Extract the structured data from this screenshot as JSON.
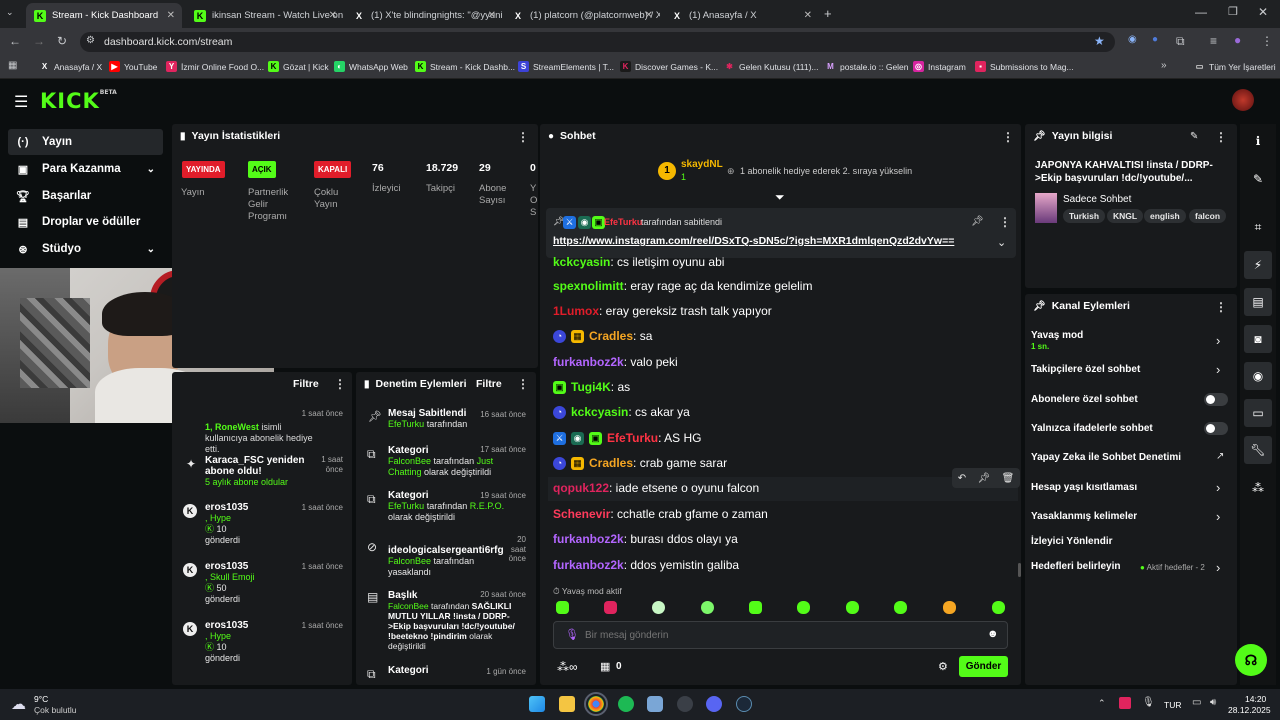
{
  "browser": {
    "tabs": [
      {
        "title": "Stream - Kick Dashboard",
        "active": true
      },
      {
        "title": "ikinsan Stream - Watch Live on"
      },
      {
        "title": "(1) X'te blindingnights: \"@yyuni"
      },
      {
        "title": "(1) platcorn (@platcornweb) / X"
      },
      {
        "title": "(1) Anasayfa / X"
      }
    ],
    "url": "dashboard.kick.com/stream",
    "bookmarks": [
      "Anasayfa / X",
      "YouTube",
      "İzmir Online Food O...",
      "Gözat | Kick",
      "WhatsApp Web",
      "Stream - Kick Dashb...",
      "StreamElements | T...",
      "Discover Games - K...",
      "Gelen Kutusu (111)...",
      "postale.io :: Gelen",
      "Instagram",
      "Submissions to Mag..."
    ],
    "all_bookmarks": "Tüm Yer İşaretleri"
  },
  "logo": {
    "text": "KICK",
    "beta": "BETA"
  },
  "sidebar": [
    {
      "label": "Yayın",
      "icon": "broadcast-icon"
    },
    {
      "label": "Para Kazanma",
      "icon": "money-icon"
    },
    {
      "label": "Başarılar",
      "icon": "trophy-icon"
    },
    {
      "label": "Droplar ve ödüller",
      "icon": "gift-icon"
    },
    {
      "label": "Stüdyo",
      "icon": "studio-icon"
    }
  ],
  "stats": {
    "title": "Yayın İstatistikleri",
    "badges": [
      {
        "text": "YAYINDA",
        "label": "Yayın",
        "color": "#e11d2a"
      },
      {
        "text": "AÇIK",
        "label": "Partnerlik Gelir Programı",
        "color": "#53fc18"
      },
      {
        "text": "KAPALI",
        "label": "Çoklu Yayın",
        "color": "#e11d2a"
      }
    ],
    "numbers": [
      {
        "value": "76",
        "label": "İzleyici"
      },
      {
        "value": "18.729",
        "label": "Takipçi"
      },
      {
        "value": "29",
        "label": "Abone Sayısı"
      },
      {
        "value": "0",
        "label": "Y O S"
      }
    ]
  },
  "activity": {
    "filter": "Filtre",
    "items": [
      {
        "user": "1, RoneWest",
        "text": "isimli kullanıcıya abonelik hediye etti.",
        "time": "1 saat önce"
      },
      {
        "user": "Karaca_FSC yeniden abone oldu!",
        "text": "5 aylık abone oldular",
        "time": "1 saat önce"
      },
      {
        "user": "eros1035",
        "sub": ", Hype",
        "amount": "10",
        "note": "gönderdi",
        "time": "1 saat önce"
      },
      {
        "user": "eros1035",
        "sub": ", Skull Emoji",
        "amount": "50",
        "note": "gönderdi",
        "time": "1 saat önce"
      },
      {
        "user": "eros1035",
        "sub": ", Hype",
        "amount": "10",
        "note": "gönderdi",
        "time": "1 saat önce"
      }
    ]
  },
  "moderation": {
    "title": "Denetim Eylemleri",
    "filter": "Filtre",
    "items": [
      {
        "title": "Mesaj Sabitlendi",
        "by": "EfeTurku",
        "rest": "tarafından",
        "time": "16 saat önce"
      },
      {
        "title": "Kategori",
        "by": "FalconBee",
        "rest": "tarafından",
        "extra": "Just Chatting",
        "rest2": "olarak değiştirildi",
        "time": "17 saat önce"
      },
      {
        "title": "Kategori",
        "by": "EfeTurku",
        "rest": "tarafından",
        "extra": "R.E.P.O.",
        "rest2": "olarak değiştirildi",
        "time": "19 saat önce"
      },
      {
        "title": "ideologicalsergeanti6rfg",
        "by": "FalconBee",
        "rest": "tarafından yasaklandı",
        "time": "20 saat önce"
      },
      {
        "title": "Başlık",
        "by": "FalconBee",
        "rest": "tarafından",
        "extra": "SAĞLIKLI MUTLU YILLAR !insta / DDRP->Ekip başvuruları !dc/!youtube/ !beetekno !pindirim",
        "rest2": "olarak değiştirildi",
        "time": "20 saat önce"
      },
      {
        "title": "Kategori",
        "time": "1 gün önce"
      }
    ]
  },
  "chat": {
    "title": "Sohbet",
    "gifter": {
      "name": "skaydNL",
      "count": "1",
      "rank": "1"
    },
    "gift_msg": "1 abonelik hediye ederek 2. sıraya yükselin",
    "pinned_by": "EfeTurku",
    "pinned_suffix": "tarafından sabitlendi",
    "pinned_link": "https://www.instagram.com/reel/DSxTQ-sDN5c/?igsh=MXR1dmlqenQzd2dvYw==",
    "messages": [
      {
        "user": "kckcyasin",
        "color": "#53fc18",
        "text": ": cs iletişim oyunu abi"
      },
      {
        "user": "spexnolimitt",
        "color": "#53fc18",
        "text": ": eray rage aç da kendimize gelelim"
      },
      {
        "user": "1Lumox",
        "color": "#e11d2a",
        "text": ": eray gereksiz trash talk yapıyor"
      },
      {
        "user": "Cradles",
        "color": "#f5a623",
        "text": ": sa"
      },
      {
        "user": "furkanboz2k",
        "color": "#b366ff",
        "text": ": valo peki"
      },
      {
        "user": "Tugi4K",
        "color": "#53fc18",
        "text": ": as"
      },
      {
        "user": "kckcyasin",
        "color": "#53fc18",
        "text": ": cs akar ya"
      },
      {
        "user": "EfeTurku",
        "color": "#ff3344",
        "text": ": AS HG"
      },
      {
        "user": "Cradles",
        "color": "#f5a623",
        "text": ": crab game sarar"
      },
      {
        "user": "qopuk122",
        "color": "#e0245e",
        "text": ": iade etsene o oyunu falcon"
      },
      {
        "user": "Schenevir",
        "color": "#ff3b5c",
        "text": ": cchatle crab gfame o zaman"
      },
      {
        "user": "furkanboz2k",
        "color": "#b366ff",
        "text": ": burası ddos olayı ya"
      },
      {
        "user": "furkanboz2k",
        "color": "#b366ff",
        "text": ": ddos yemistin galiba"
      }
    ],
    "slow_mode": "Yavaş mod aktif",
    "placeholder": "Bir mesaj gönderin",
    "send": "Gönder",
    "points": "0"
  },
  "stream_info": {
    "title": "Yayın bilgisi",
    "stream_title": "JAPONYA KAHVALTISI !insta / DDRP->Ekip başvuruları !dc/!youtube/...",
    "category": "Sadece Sohbet",
    "tags": [
      "Turkish",
      "KNGL",
      "english",
      "falcon"
    ]
  },
  "channel_actions": {
    "title": "Kanal Eylemleri",
    "items": [
      {
        "label": "Yavaş mod",
        "sub": "1 sn."
      },
      {
        "label": "Takipçilere özel sohbet"
      },
      {
        "label": "Abonelere özel sohbet"
      },
      {
        "label": "Yalnızca ifadelerle sohbet"
      },
      {
        "label": "Yapay Zeka ile Sohbet Denetimi"
      },
      {
        "label": "Hesap yaşı kısıtlaması"
      },
      {
        "label": "Yasaklanmış kelimeler"
      },
      {
        "label": "İzleyici Yönlendir"
      },
      {
        "label": "Hedefleri belirleyin",
        "sub": "Aktif hedefler - 2"
      }
    ]
  },
  "taskbar": {
    "weather_temp": "9°C",
    "weather_desc": "Çok bulutlu",
    "lang": "TUR",
    "time": "14:20",
    "date": "28.12.2025"
  }
}
